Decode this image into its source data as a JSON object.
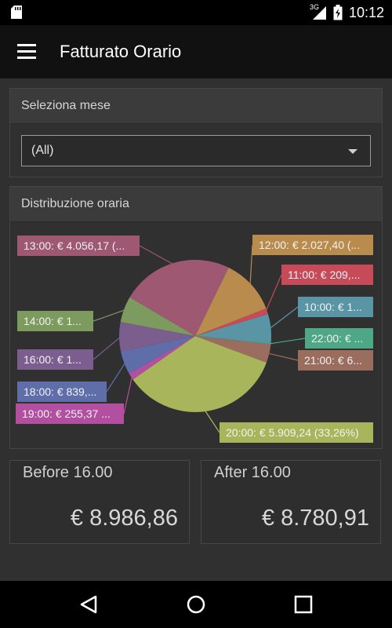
{
  "status_bar": {
    "network": "3G",
    "time": "10:12",
    "icons": [
      "sd-card-icon",
      "signal-icon",
      "battery-icon"
    ]
  },
  "app_bar": {
    "title": "Fatturato Orario",
    "menu_icon": "hamburger-menu-icon"
  },
  "month_filter": {
    "header": "Seleziona mese",
    "selected": "(All)"
  },
  "distribution": {
    "header": "Distribuzione oraria"
  },
  "chart_data": {
    "type": "pie",
    "title": "",
    "slices": [
      {
        "label": "10:00: € 1...",
        "percent": 6.0,
        "color": "#5a95a5"
      },
      {
        "label": "11:00: € 209,...",
        "percent": 1.18,
        "color": "#c64a57"
      },
      {
        "label": "12:00: € 2.027,40 (...",
        "percent": 11.41,
        "color": "#b98c4e"
      },
      {
        "label": "13:00: € 4.056,17 (...",
        "percent": 22.83,
        "color": "#9f5872"
      },
      {
        "label": "14:00: € 1...",
        "percent": 5.3,
        "color": "#7d9a5f"
      },
      {
        "label": "16:00: € 1...",
        "percent": 6.0,
        "color": "#7c5e8e"
      },
      {
        "label": "18:00: € 839,...",
        "percent": 4.72,
        "color": "#5f6ea8"
      },
      {
        "label": "19:00: € 255,37 ...",
        "percent": 1.44,
        "color": "#b24fa1"
      },
      {
        "label": "20:00: € 5.909,24 (33,26%)",
        "percent": 33.26,
        "color": "#a9b55a"
      },
      {
        "label": "21:00: € 6...",
        "percent": 3.77,
        "color": "#9a6d5f"
      },
      {
        "label": "22:00: € ...",
        "percent": 0.15,
        "color": "#4ea886"
      }
    ]
  },
  "totals": {
    "before": {
      "label": "Before 16.00",
      "value": "€ 8.986,86"
    },
    "after": {
      "label": "After 16.00",
      "value": "€ 8.780,91"
    }
  },
  "nav": {
    "back_icon": "back-triangle-icon",
    "home_icon": "home-circle-icon",
    "recents_icon": "recents-square-icon"
  }
}
